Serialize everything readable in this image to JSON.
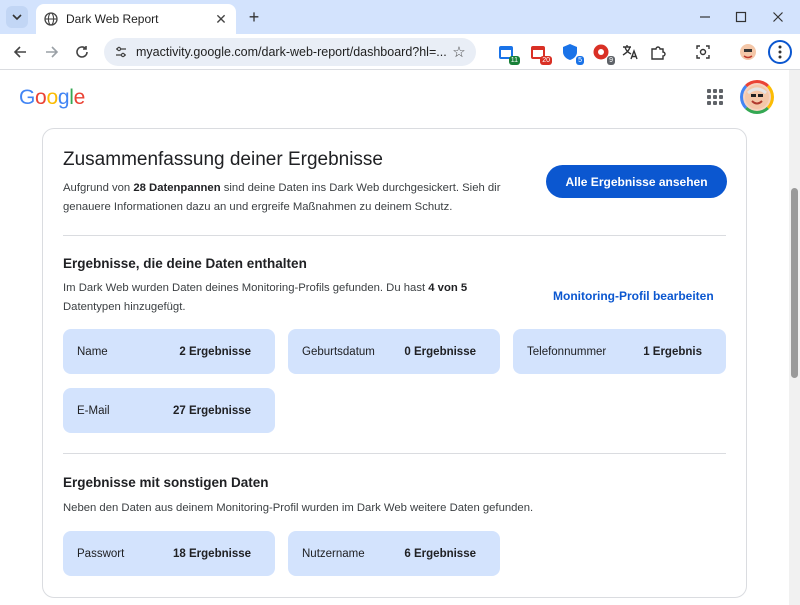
{
  "browser": {
    "tab_title": "Dark Web Report",
    "url": "myactivity.google.com/dark-web-report/dashboard?hl=...",
    "extensions": [
      {
        "icon": "calendar-extension-icon",
        "badge": "11",
        "badge_color": "#188038"
      },
      {
        "icon": "calendar-extension-icon",
        "badge": "20",
        "badge_color": "#d93025"
      },
      {
        "icon": "shield-extension-icon",
        "badge": "5",
        "badge_color": "#1a73e8"
      },
      {
        "icon": "red-circle-extension-icon",
        "badge": "9",
        "badge_color": "#5f6368"
      }
    ]
  },
  "header": {
    "logo_text": "Google"
  },
  "summary": {
    "title": "Zusammenfassung deiner Ergebnisse",
    "text_before": "Aufgrund von ",
    "text_bold": "28 Datenpannen",
    "text_after": " sind deine Daten ins Dark Web durchgesickert. Sieh dir genauere Informationen dazu an und ergreife Maßnahmen zu deinem Schutz.",
    "button_label": "Alle Ergebnisse ansehen"
  },
  "section_profile": {
    "title": "Ergebnisse, die deine Daten enthalten",
    "text_before": "Im Dark Web wurden Daten deines Monitoring-Profils gefunden. Du hast ",
    "text_bold1": "4 von 5",
    "text_after": " Datentypen hinzugefügt.",
    "link_label": "Monitoring-Profil bearbeiten",
    "tiles": [
      {
        "label": "Name",
        "count": "2 Ergebnisse"
      },
      {
        "label": "Geburtsdatum",
        "count": "0 Ergebnisse"
      },
      {
        "label": "Telefonnummer",
        "count": "1 Ergebnis"
      },
      {
        "label": "E-Mail",
        "count": "27 Ergebnisse"
      }
    ]
  },
  "section_other": {
    "title": "Ergebnisse mit sonstigen Daten",
    "text": "Neben den Daten aus deinem Monitoring-Profil wurden im Dark Web weitere Daten gefunden.",
    "tiles": [
      {
        "label": "Passwort",
        "count": "18 Ergebnisse"
      },
      {
        "label": "Nutzername",
        "count": "6 Ergebnisse"
      }
    ]
  },
  "colors": {
    "accent": "#0b57d0",
    "tile_bg": "#d3e3fd",
    "tabstrip_bg": "#d3e3fd"
  }
}
